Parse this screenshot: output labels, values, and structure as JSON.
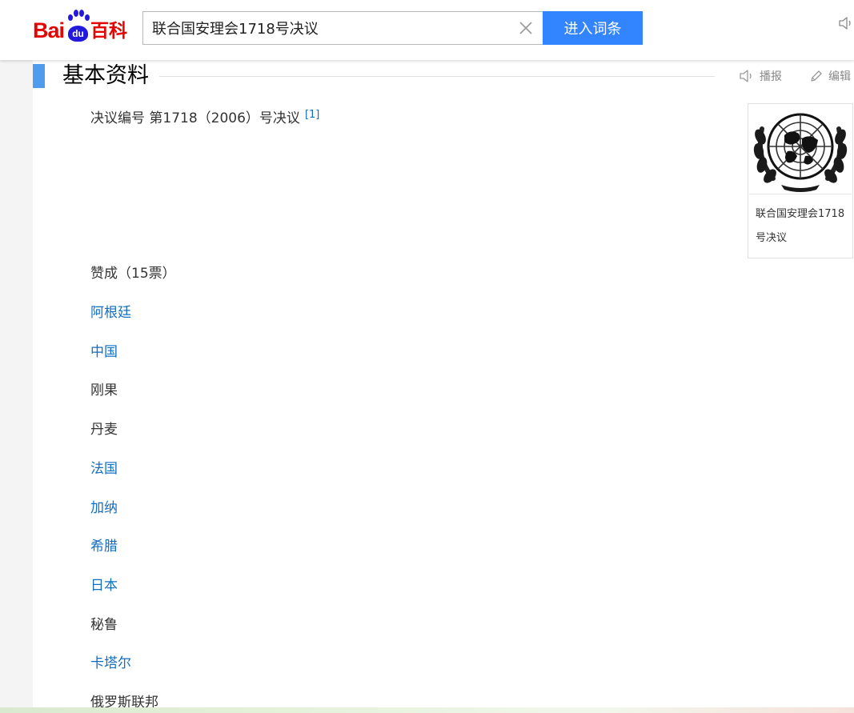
{
  "header": {
    "logo": {
      "bai": "Bai",
      "du": "du",
      "baike": "百科"
    },
    "search": {
      "value": "联合国安理会1718号决议"
    },
    "search_button_label": "进入词条"
  },
  "section": {
    "title": "基本资料",
    "actions": {
      "broadcast": "播报",
      "edit": "编辑"
    }
  },
  "content": {
    "resolution_line": "决议编号 第1718（2006）号决议",
    "footnote": "[1]",
    "votes_title": "赞成（15票）",
    "countries": [
      {
        "name": "阿根廷",
        "link": true
      },
      {
        "name": "中国",
        "link": true
      },
      {
        "name": "刚果",
        "link": false
      },
      {
        "name": "丹麦",
        "link": false
      },
      {
        "name": "法国",
        "link": true
      },
      {
        "name": "加纳",
        "link": true
      },
      {
        "name": "希腊",
        "link": true
      },
      {
        "name": "日本",
        "link": true
      },
      {
        "name": "秘鲁",
        "link": false
      },
      {
        "name": "卡塔尔",
        "link": true
      },
      {
        "name": "俄罗斯联邦",
        "link": false
      }
    ]
  },
  "side_card": {
    "caption": "联合国安理会1718号决议",
    "image_icon": "un-emblem-icon"
  },
  "colors": {
    "link": "#136ec2",
    "accent": "#3385ff",
    "section_bar": "#4f9cee",
    "logo_red": "#e10602",
    "logo_blue": "#2319dc"
  }
}
